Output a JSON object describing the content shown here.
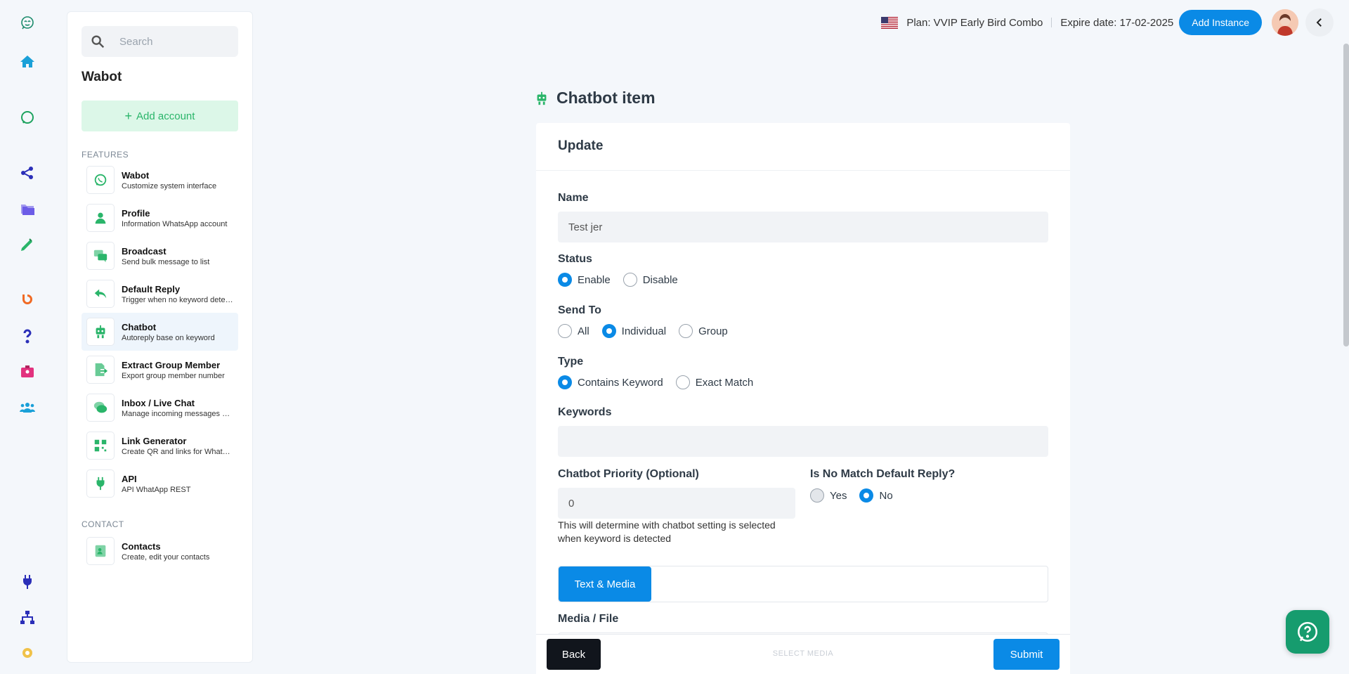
{
  "sidebar": {
    "search_placeholder": "Search",
    "title": "Wabot",
    "add_account": "Add account",
    "features_label": "FEATURES",
    "contact_label": "CONTACT",
    "features": [
      {
        "title": "Wabot",
        "subtitle": "Customize system interface",
        "icon": "whatsapp-icon"
      },
      {
        "title": "Profile",
        "subtitle": "Information WhatsApp account",
        "icon": "user-icon"
      },
      {
        "title": "Broadcast",
        "subtitle": "Send bulk message to list",
        "icon": "chat-bubbles-icon"
      },
      {
        "title": "Default Reply",
        "subtitle": "Trigger when no keyword detected",
        "icon": "reply-icon"
      },
      {
        "title": "Chatbot",
        "subtitle": "Autoreply base on keyword",
        "icon": "robot-icon"
      },
      {
        "title": "Extract Group Member",
        "subtitle": "Export group member number",
        "icon": "export-icon"
      },
      {
        "title": "Inbox / Live Chat",
        "subtitle": "Manage incoming messages and chats",
        "icon": "chat-icon"
      },
      {
        "title": "Link Generator",
        "subtitle": "Create QR and links for WhatsApp",
        "icon": "qr-icon"
      },
      {
        "title": "API",
        "subtitle": "API WhatApp REST",
        "icon": "plug-icon"
      }
    ],
    "contacts": [
      {
        "title": "Contacts",
        "subtitle": "Create, edit your contacts",
        "icon": "contact-card-icon"
      }
    ]
  },
  "topbar": {
    "plan": "Plan: VVIP Early Bird Combo",
    "expire": "Expire date: 17-02-2025",
    "add_instance": "Add Instance"
  },
  "page": {
    "title": "Chatbot item",
    "card_title": "Update"
  },
  "form": {
    "name_label": "Name",
    "name_value": "Test jer",
    "status_label": "Status",
    "status_options": [
      "Enable",
      "Disable"
    ],
    "status_selected": "Enable",
    "send_to_label": "Send To",
    "send_to_options": [
      "All",
      "Individual",
      "Group"
    ],
    "send_to_selected": "Individual",
    "type_label": "Type",
    "type_options": [
      "Contains Keyword",
      "Exact Match"
    ],
    "type_selected": "Contains Keyword",
    "keywords_label": "Keywords",
    "keywords_value": "",
    "priority_label": "Chatbot Priority (Optional)",
    "priority_value": "0",
    "priority_help": "This will determine with chatbot setting is selected when keyword is detected",
    "no_match_label": "Is No Match Default Reply?",
    "no_match_options": [
      "Yes",
      "No"
    ],
    "no_match_selected": "No",
    "tab_label": "Text & Media",
    "media_label": "Media / File"
  },
  "footer": {
    "back": "Back",
    "select_media": "SELECT MEDIA",
    "submit": "Submit"
  },
  "colors": {
    "accent": "#0a8ae6",
    "brand_green": "#2ab56a",
    "rail_blue": "#2b2fb8"
  }
}
